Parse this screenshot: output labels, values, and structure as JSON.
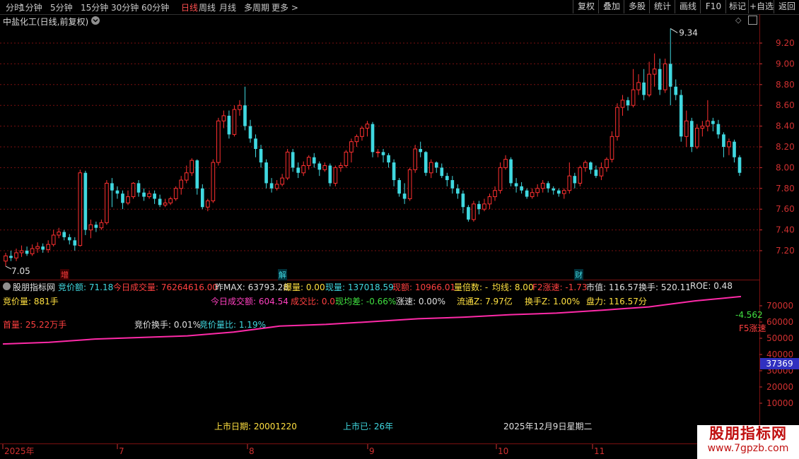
{
  "toolbar": {
    "periods": [
      "分时",
      "1分钟",
      "5分钟",
      "15分钟",
      "30分钟",
      "60分钟",
      "日线",
      "周线",
      "月线",
      "多周期",
      "更多 >"
    ],
    "active_period": "日线",
    "right_buttons": [
      "复权",
      "叠加",
      "多股",
      "统计",
      "画线",
      "F10",
      "标记",
      "+自选",
      "返回"
    ]
  },
  "stock_title": "中盐化工(日线,前复权)",
  "price_labels": {
    "high": "9.34",
    "low": "7.05"
  },
  "event_marks": [
    "增",
    "解",
    "财"
  ],
  "colors": {
    "up": "#ff3030",
    "down": "#40d8e0",
    "grid": "#7a1010",
    "axis_text": "#d03030",
    "line": "#ff2aa8"
  },
  "chart_data": [
    {
      "type": "candlestick",
      "title": "中盐化工(日线,前复权)",
      "y_ticks": [
        "9.20",
        "9.00",
        "8.80",
        "8.60",
        "8.40",
        "8.20",
        "8.00",
        "7.80",
        "7.60",
        "7.40",
        "7.20"
      ],
      "ylim": [
        7.05,
        9.34
      ],
      "grid": true,
      "x_labels": [
        "2025年",
        "7",
        "8",
        "9",
        "10",
        "11"
      ],
      "candles": [
        [
          7.1,
          7.15,
          7.05,
          7.18
        ],
        [
          7.15,
          7.13,
          7.1,
          7.2
        ],
        [
          7.13,
          7.18,
          7.1,
          7.22
        ],
        [
          7.18,
          7.2,
          7.14,
          7.25
        ],
        [
          7.2,
          7.17,
          7.15,
          7.24
        ],
        [
          7.17,
          7.22,
          7.15,
          7.26
        ],
        [
          7.22,
          7.24,
          7.18,
          7.28
        ],
        [
          7.24,
          7.21,
          7.18,
          7.27
        ],
        [
          7.21,
          7.26,
          7.18,
          7.3
        ],
        [
          7.26,
          7.35,
          7.24,
          7.4
        ],
        [
          7.35,
          7.38,
          7.32,
          7.42
        ],
        [
          7.38,
          7.33,
          7.3,
          7.4
        ],
        [
          7.33,
          7.3,
          7.26,
          7.36
        ],
        [
          7.3,
          7.25,
          7.2,
          7.33
        ],
        [
          7.25,
          7.95,
          7.24,
          7.98
        ],
        [
          7.95,
          7.4,
          7.35,
          7.97
        ],
        [
          7.4,
          7.45,
          7.32,
          7.5
        ],
        [
          7.45,
          7.42,
          7.38,
          7.48
        ],
        [
          7.42,
          7.47,
          7.4,
          7.5
        ],
        [
          7.47,
          7.85,
          7.45,
          7.88
        ],
        [
          7.85,
          7.78,
          7.62,
          7.9
        ],
        [
          7.78,
          7.75,
          7.7,
          7.82
        ],
        [
          7.75,
          7.66,
          7.6,
          7.78
        ],
        [
          7.66,
          7.72,
          7.64,
          7.78
        ],
        [
          7.72,
          7.85,
          7.7,
          7.86
        ],
        [
          7.85,
          7.76,
          7.72,
          7.88
        ],
        [
          7.76,
          7.72,
          7.68,
          7.8
        ],
        [
          7.72,
          7.75,
          7.7,
          7.78
        ],
        [
          7.75,
          7.7,
          7.65,
          7.78
        ],
        [
          7.7,
          7.64,
          7.62,
          7.74
        ],
        [
          7.64,
          7.66,
          7.62,
          7.7
        ],
        [
          7.66,
          7.7,
          7.64,
          7.72
        ],
        [
          7.7,
          7.8,
          7.68,
          7.82
        ],
        [
          7.8,
          7.88,
          7.74,
          7.92
        ],
        [
          7.88,
          7.95,
          7.85,
          8.02
        ],
        [
          7.95,
          8.07,
          7.92,
          8.09
        ],
        [
          8.07,
          7.8,
          7.74,
          8.08
        ],
        [
          7.8,
          7.62,
          7.6,
          7.84
        ],
        [
          7.62,
          7.68,
          7.58,
          7.7
        ],
        [
          7.68,
          8.05,
          7.66,
          8.08
        ],
        [
          8.05,
          8.45,
          8.02,
          8.48
        ],
        [
          8.45,
          8.5,
          8.38,
          8.55
        ],
        [
          8.5,
          8.32,
          8.28,
          8.55
        ],
        [
          8.32,
          8.56,
          8.3,
          8.6
        ],
        [
          8.56,
          8.6,
          8.5,
          8.65
        ],
        [
          8.6,
          8.4,
          8.36,
          8.78
        ],
        [
          8.4,
          8.28,
          8.24,
          8.46
        ],
        [
          8.28,
          8.18,
          8.1,
          8.32
        ],
        [
          8.18,
          8.05,
          8.0,
          8.22
        ],
        [
          8.05,
          7.85,
          7.8,
          8.08
        ],
        [
          7.85,
          7.8,
          7.76,
          7.9
        ],
        [
          7.8,
          7.84,
          7.78,
          7.88
        ],
        [
          7.84,
          7.9,
          7.82,
          7.94
        ],
        [
          7.9,
          8.15,
          7.88,
          8.18
        ],
        [
          8.15,
          8.0,
          7.96,
          8.18
        ],
        [
          8.0,
          7.95,
          7.9,
          8.05
        ],
        [
          7.95,
          8.02,
          7.92,
          8.06
        ],
        [
          8.02,
          8.1,
          7.98,
          8.12
        ],
        [
          8.1,
          8.04,
          8.0,
          8.14
        ],
        [
          8.04,
          7.98,
          7.92,
          8.06
        ],
        [
          7.98,
          8.02,
          7.96,
          8.05
        ],
        [
          8.02,
          7.85,
          7.82,
          8.04
        ],
        [
          7.85,
          8.0,
          7.82,
          8.02
        ],
        [
          8.0,
          8.02,
          7.96,
          8.05
        ],
        [
          8.02,
          8.15,
          8.0,
          8.17
        ],
        [
          8.15,
          8.25,
          8.05,
          8.28
        ],
        [
          8.25,
          8.3,
          8.2,
          8.32
        ],
        [
          8.3,
          8.38,
          8.26,
          8.4
        ],
        [
          8.38,
          8.42,
          8.3,
          8.45
        ],
        [
          8.42,
          8.15,
          8.1,
          8.44
        ],
        [
          8.15,
          8.15,
          8.1,
          8.18
        ],
        [
          8.15,
          8.12,
          8.05,
          8.18
        ],
        [
          8.12,
          8.05,
          8.0,
          8.14
        ],
        [
          8.05,
          7.88,
          7.82,
          8.08
        ],
        [
          7.88,
          7.75,
          7.72,
          7.9
        ],
        [
          7.75,
          7.7,
          7.65,
          7.85
        ],
        [
          7.7,
          7.98,
          7.68,
          8.0
        ],
        [
          7.98,
          8.18,
          7.95,
          8.22
        ],
        [
          8.18,
          8.15,
          8.1,
          8.25
        ],
        [
          8.15,
          7.95,
          7.92,
          8.16
        ],
        [
          7.95,
          8.05,
          7.9,
          8.08
        ],
        [
          8.05,
          8.0,
          7.95,
          8.06
        ],
        [
          8.0,
          7.92,
          7.9,
          8.04
        ],
        [
          7.92,
          7.88,
          7.82,
          7.95
        ],
        [
          7.88,
          7.8,
          7.75,
          7.92
        ],
        [
          7.8,
          7.75,
          7.7,
          7.84
        ],
        [
          7.75,
          7.62,
          7.56,
          7.78
        ],
        [
          7.62,
          7.5,
          7.48,
          7.64
        ],
        [
          7.5,
          7.65,
          7.48,
          7.68
        ],
        [
          7.65,
          7.6,
          7.55,
          7.68
        ],
        [
          7.6,
          7.65,
          7.58,
          7.7
        ],
        [
          7.65,
          7.72,
          7.6,
          7.75
        ],
        [
          7.72,
          7.78,
          7.68,
          7.82
        ],
        [
          7.78,
          8.0,
          7.75,
          8.05
        ],
        [
          8.0,
          8.08,
          7.98,
          8.12
        ],
        [
          8.08,
          7.85,
          7.82,
          8.1
        ],
        [
          7.85,
          7.82,
          7.76,
          7.9
        ],
        [
          7.82,
          7.78,
          7.75,
          7.86
        ],
        [
          7.78,
          7.72,
          7.7,
          7.8
        ],
        [
          7.72,
          7.76,
          7.7,
          7.8
        ],
        [
          7.76,
          7.8,
          7.72,
          7.84
        ],
        [
          7.8,
          7.85,
          7.76,
          7.88
        ],
        [
          7.85,
          7.8,
          7.76,
          7.87
        ],
        [
          7.8,
          7.78,
          7.74,
          7.82
        ],
        [
          7.78,
          7.75,
          7.72,
          7.8
        ],
        [
          7.75,
          7.78,
          7.7,
          7.8
        ],
        [
          7.78,
          7.92,
          7.75,
          8.05
        ],
        [
          7.92,
          7.85,
          7.8,
          7.95
        ],
        [
          7.85,
          8.0,
          7.82,
          8.02
        ],
        [
          8.0,
          8.05,
          7.96,
          8.07
        ],
        [
          8.05,
          7.98,
          7.94,
          8.06
        ],
        [
          7.98,
          7.92,
          7.9,
          8.02
        ],
        [
          7.92,
          8.0,
          7.88,
          8.05
        ],
        [
          8.0,
          8.08,
          7.96,
          8.1
        ],
        [
          8.08,
          8.3,
          8.05,
          8.35
        ],
        [
          8.3,
          8.58,
          8.26,
          8.62
        ],
        [
          8.58,
          8.65,
          8.5,
          8.7
        ],
        [
          8.65,
          8.6,
          8.55,
          8.68
        ],
        [
          8.6,
          8.75,
          8.58,
          8.95
        ],
        [
          8.75,
          8.82,
          8.7,
          8.9
        ],
        [
          8.82,
          8.7,
          8.65,
          8.95
        ],
        [
          8.7,
          8.9,
          8.68,
          9.02
        ],
        [
          8.9,
          8.95,
          8.78,
          9.1
        ],
        [
          8.95,
          8.75,
          8.7,
          9.05
        ],
        [
          8.75,
          9.0,
          8.72,
          9.05
        ],
        [
          9.0,
          8.78,
          8.6,
          9.34
        ],
        [
          8.78,
          8.7,
          8.65,
          8.85
        ],
        [
          8.7,
          8.3,
          8.25,
          8.75
        ],
        [
          8.3,
          8.45,
          8.2,
          8.55
        ],
        [
          8.45,
          8.2,
          8.15,
          8.48
        ],
        [
          8.2,
          8.38,
          8.18,
          8.42
        ],
        [
          8.38,
          8.4,
          8.3,
          8.45
        ],
        [
          8.4,
          8.45,
          8.35,
          8.65
        ],
        [
          8.45,
          8.42,
          8.35,
          8.48
        ],
        [
          8.42,
          8.32,
          8.28,
          8.46
        ],
        [
          8.32,
          8.2,
          8.1,
          8.34
        ],
        [
          8.2,
          8.25,
          8.12,
          8.28
        ],
        [
          8.25,
          8.1,
          8.05,
          8.27
        ],
        [
          8.1,
          7.95,
          7.92,
          8.12
        ]
      ]
    },
    {
      "type": "line",
      "name": "股朋指标网",
      "y_ticks": [
        "70000",
        "60000",
        "50000",
        "40000",
        "30000",
        "20000",
        "10000"
      ],
      "ylim": [
        0,
        80000
      ],
      "x": [
        0,
        1,
        2,
        3,
        4,
        5,
        6,
        7,
        8,
        9,
        10,
        11,
        12,
        13,
        14,
        15,
        16
      ],
      "values": [
        46500,
        47500,
        49500,
        50500,
        51500,
        53800,
        57500,
        58500,
        60200,
        62000,
        63000,
        64500,
        65500,
        67300,
        69300,
        73000,
        75700
      ]
    }
  ],
  "indicator_bar": {
    "title": "股朋指标网",
    "items": [
      {
        "label": "竞价额:",
        "value": "71.18"
      },
      {
        "label": "今日成交量:",
        "value": "76264616.00"
      },
      {
        "label": "昨MAX:",
        "value": "63793.28"
      },
      {
        "label": "爆量:",
        "value": "0.00"
      },
      {
        "label": "现量:",
        "value": "137018.59"
      },
      {
        "label": "现额:",
        "value": "10966.01"
      },
      {
        "label": "量倍数:",
        "value": "-"
      },
      {
        "label": "均线:",
        "value": "8.00"
      },
      {
        "label": "F2涨速:",
        "value": "-1.73"
      },
      {
        "label": "市值:",
        "value": "116.57"
      },
      {
        "label": "换手:",
        "value": "520.11"
      },
      {
        "label": "ROE:",
        "value": "0.48"
      }
    ]
  },
  "indicator_texts": {
    "bid_volume": "竞价量: 881手",
    "today_amount": "今日成交额: 604.54",
    "deal_ratio": "成交比: 0.0",
    "current_avg_diff": "现均差: -0.66%",
    "rise_speed": "涨速: 0.00%",
    "float_value": "流通Z: 7.97亿",
    "turnover_z": "换手Z: 1.00%",
    "capacity": "盘力: 116.57分",
    "first_volume": "首量: 25.22万手",
    "bid_turnover": "竞价换手: 0.01%",
    "bid_ratio": "竞价量比: 1.19%",
    "listing_date": "上市日期: 20001220",
    "listed_years": "上市已: 26年",
    "date": "2025年12月9日星期二",
    "right_value1": "-4.562",
    "right_value2": "F5涨速",
    "cursor_value": "37369"
  },
  "watermark": {
    "line1": "股朋指标网",
    "line2": "www.7gpzb.com"
  }
}
